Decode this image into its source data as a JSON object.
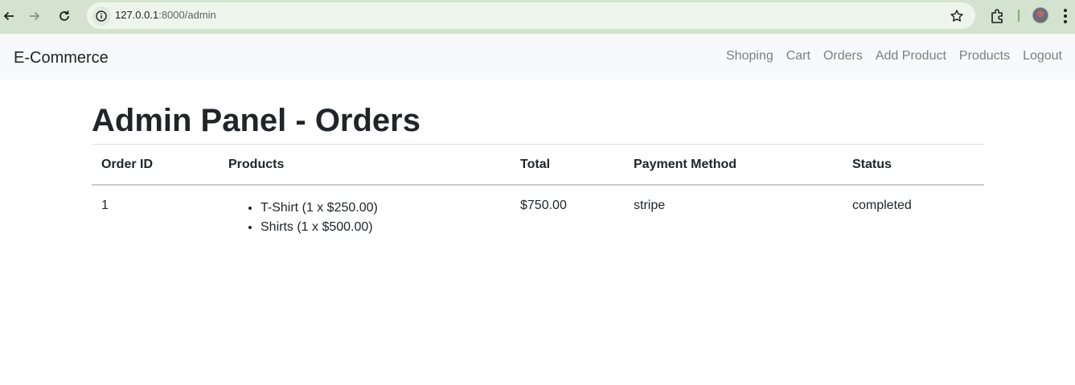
{
  "browser": {
    "url_host": "127.0.0.1",
    "url_path": ":8000/admin"
  },
  "navbar": {
    "brand": "E-Commerce",
    "links": [
      "Shoping",
      "Cart",
      "Orders",
      "Add Product",
      "Products",
      "Logout"
    ]
  },
  "page": {
    "title": "Admin Panel - Orders"
  },
  "table": {
    "headers": [
      "Order ID",
      "Products",
      "Total",
      "Payment Method",
      "Status"
    ],
    "rows": [
      {
        "order_id": "1",
        "products": [
          "T-Shirt (1 x $250.00)",
          "Shirts (1 x $500.00)"
        ],
        "total": "$750.00",
        "payment_method": "stripe",
        "status": "completed"
      }
    ]
  }
}
